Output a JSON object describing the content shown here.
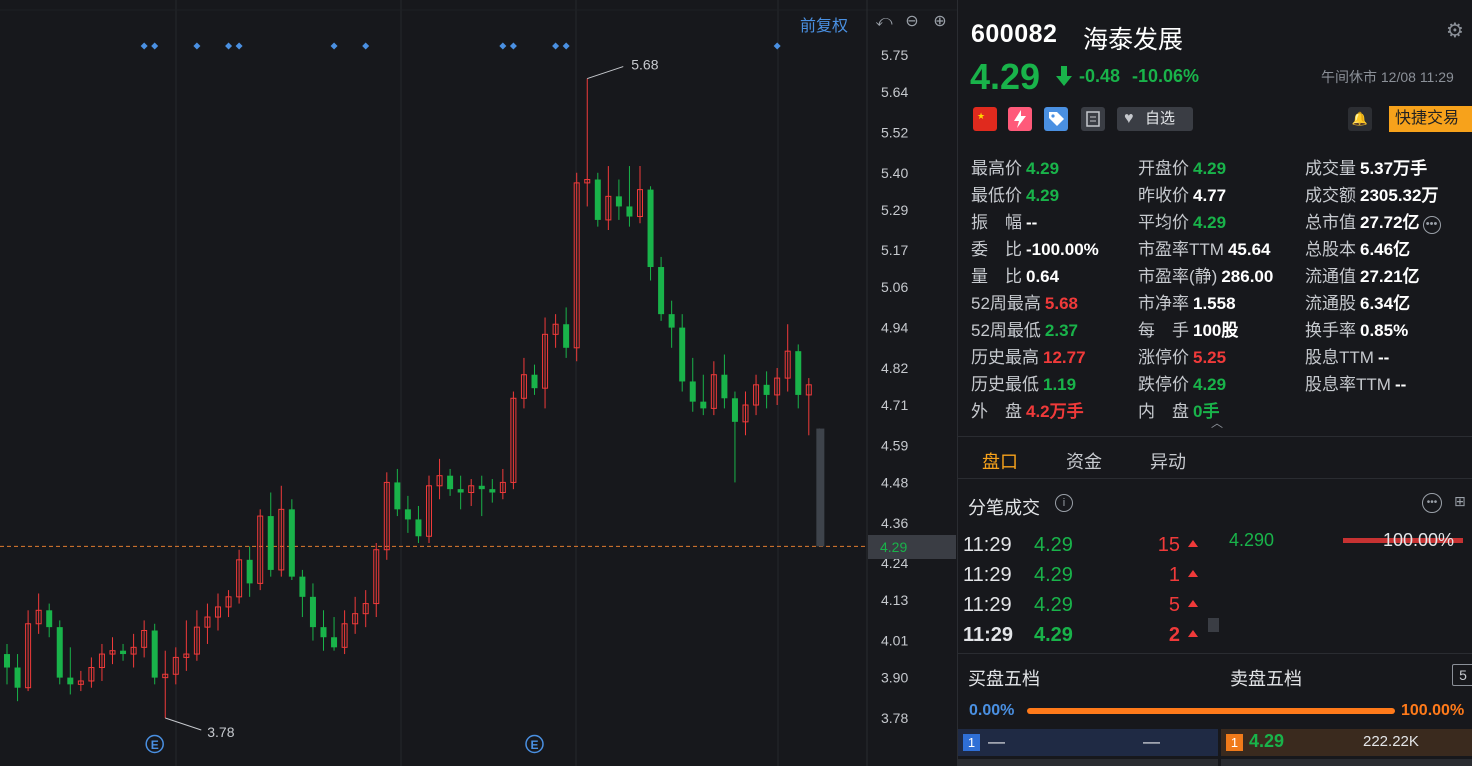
{
  "chart_data": {
    "type": "candlestick",
    "ylim": [
      3.72,
      5.8
    ],
    "y_ticks": [
      "5.75",
      "5.64",
      "5.52",
      "5.40",
      "5.29",
      "5.17",
      "5.06",
      "4.94",
      "4.82",
      "4.71",
      "4.59",
      "4.48",
      "4.36",
      "4.29",
      "4.24",
      "4.13",
      "4.01",
      "3.90",
      "3.78"
    ],
    "current_price": "4.29",
    "high_label": "5.68",
    "low_label": "3.78",
    "event_marker": "E",
    "up_color": "#f03a3a",
    "down_color": "#19b34a",
    "candles": [
      {
        "o": 3.97,
        "h": 4.0,
        "l": 3.88,
        "c": 3.93
      },
      {
        "o": 3.93,
        "h": 3.97,
        "l": 3.83,
        "c": 3.87
      },
      {
        "o": 3.87,
        "h": 4.1,
        "l": 3.86,
        "c": 4.06
      },
      {
        "o": 4.06,
        "h": 4.15,
        "l": 4.03,
        "c": 4.1
      },
      {
        "o": 4.1,
        "h": 4.12,
        "l": 4.02,
        "c": 4.05
      },
      {
        "o": 4.05,
        "h": 4.07,
        "l": 3.88,
        "c": 3.9
      },
      {
        "o": 3.9,
        "h": 3.99,
        "l": 3.85,
        "c": 3.88
      },
      {
        "o": 3.88,
        "h": 3.92,
        "l": 3.86,
        "c": 3.89
      },
      {
        "o": 3.89,
        "h": 3.96,
        "l": 3.87,
        "c": 3.93
      },
      {
        "o": 3.93,
        "h": 4.0,
        "l": 3.89,
        "c": 3.97
      },
      {
        "o": 3.97,
        "h": 4.02,
        "l": 3.94,
        "c": 3.98
      },
      {
        "o": 3.98,
        "h": 4.0,
        "l": 3.95,
        "c": 3.97
      },
      {
        "o": 3.97,
        "h": 4.03,
        "l": 3.93,
        "c": 3.99
      },
      {
        "o": 3.99,
        "h": 4.07,
        "l": 3.96,
        "c": 4.04
      },
      {
        "o": 4.04,
        "h": 4.06,
        "l": 3.88,
        "c": 3.9
      },
      {
        "o": 3.9,
        "h": 3.98,
        "l": 3.78,
        "c": 3.91
      },
      {
        "o": 3.91,
        "h": 3.99,
        "l": 3.88,
        "c": 3.96
      },
      {
        "o": 3.96,
        "h": 4.07,
        "l": 3.92,
        "c": 3.97
      },
      {
        "o": 3.97,
        "h": 4.1,
        "l": 3.95,
        "c": 4.05
      },
      {
        "o": 4.05,
        "h": 4.12,
        "l": 4.0,
        "c": 4.08
      },
      {
        "o": 4.08,
        "h": 4.15,
        "l": 4.04,
        "c": 4.11
      },
      {
        "o": 4.11,
        "h": 4.16,
        "l": 4.08,
        "c": 4.14
      },
      {
        "o": 4.14,
        "h": 4.28,
        "l": 4.12,
        "c": 4.25
      },
      {
        "o": 4.25,
        "h": 4.29,
        "l": 4.14,
        "c": 4.18
      },
      {
        "o": 4.18,
        "h": 4.4,
        "l": 4.16,
        "c": 4.38
      },
      {
        "o": 4.38,
        "h": 4.45,
        "l": 4.2,
        "c": 4.22
      },
      {
        "o": 4.22,
        "h": 4.47,
        "l": 4.2,
        "c": 4.4
      },
      {
        "o": 4.4,
        "h": 4.43,
        "l": 4.19,
        "c": 4.2
      },
      {
        "o": 4.2,
        "h": 4.22,
        "l": 4.08,
        "c": 4.14
      },
      {
        "o": 4.14,
        "h": 4.18,
        "l": 4.01,
        "c": 4.05
      },
      {
        "o": 4.05,
        "h": 4.1,
        "l": 3.98,
        "c": 4.02
      },
      {
        "o": 4.02,
        "h": 4.08,
        "l": 3.98,
        "c": 3.99
      },
      {
        "o": 3.99,
        "h": 4.1,
        "l": 3.97,
        "c": 4.06
      },
      {
        "o": 4.06,
        "h": 4.14,
        "l": 4.03,
        "c": 4.09
      },
      {
        "o": 4.09,
        "h": 4.16,
        "l": 4.05,
        "c": 4.12
      },
      {
        "o": 4.12,
        "h": 4.3,
        "l": 4.08,
        "c": 4.28
      },
      {
        "o": 4.28,
        "h": 4.51,
        "l": 4.25,
        "c": 4.48
      },
      {
        "o": 4.48,
        "h": 4.52,
        "l": 4.38,
        "c": 4.4
      },
      {
        "o": 4.4,
        "h": 4.44,
        "l": 4.33,
        "c": 4.37
      },
      {
        "o": 4.37,
        "h": 4.41,
        "l": 4.3,
        "c": 4.32
      },
      {
        "o": 4.32,
        "h": 4.5,
        "l": 4.3,
        "c": 4.47
      },
      {
        "o": 4.47,
        "h": 4.55,
        "l": 4.43,
        "c": 4.5
      },
      {
        "o": 4.5,
        "h": 4.52,
        "l": 4.44,
        "c": 4.46
      },
      {
        "o": 4.46,
        "h": 4.5,
        "l": 4.4,
        "c": 4.45
      },
      {
        "o": 4.45,
        "h": 4.49,
        "l": 4.41,
        "c": 4.47
      },
      {
        "o": 4.47,
        "h": 4.5,
        "l": 4.38,
        "c": 4.46
      },
      {
        "o": 4.46,
        "h": 4.49,
        "l": 4.42,
        "c": 4.45
      },
      {
        "o": 4.45,
        "h": 4.52,
        "l": 4.43,
        "c": 4.48
      },
      {
        "o": 4.48,
        "h": 4.75,
        "l": 4.46,
        "c": 4.73
      },
      {
        "o": 4.73,
        "h": 4.85,
        "l": 4.7,
        "c": 4.8
      },
      {
        "o": 4.8,
        "h": 4.83,
        "l": 4.74,
        "c": 4.76
      },
      {
        "o": 4.76,
        "h": 4.97,
        "l": 4.7,
        "c": 4.92
      },
      {
        "o": 4.92,
        "h": 4.98,
        "l": 4.88,
        "c": 4.95
      },
      {
        "o": 4.95,
        "h": 5.0,
        "l": 4.85,
        "c": 4.88
      },
      {
        "o": 4.88,
        "h": 5.4,
        "l": 4.84,
        "c": 5.37
      },
      {
        "o": 5.37,
        "h": 5.68,
        "l": 5.3,
        "c": 5.38
      },
      {
        "o": 5.38,
        "h": 5.4,
        "l": 5.24,
        "c": 5.26
      },
      {
        "o": 5.26,
        "h": 5.42,
        "l": 5.23,
        "c": 5.33
      },
      {
        "o": 5.33,
        "h": 5.38,
        "l": 5.26,
        "c": 5.3
      },
      {
        "o": 5.3,
        "h": 5.42,
        "l": 5.24,
        "c": 5.27
      },
      {
        "o": 5.27,
        "h": 5.42,
        "l": 5.25,
        "c": 5.35
      },
      {
        "o": 5.35,
        "h": 5.36,
        "l": 5.08,
        "c": 5.12
      },
      {
        "o": 5.12,
        "h": 5.15,
        "l": 4.96,
        "c": 4.98
      },
      {
        "o": 4.98,
        "h": 5.02,
        "l": 4.88,
        "c": 4.94
      },
      {
        "o": 4.94,
        "h": 4.98,
        "l": 4.75,
        "c": 4.78
      },
      {
        "o": 4.78,
        "h": 4.85,
        "l": 4.69,
        "c": 4.72
      },
      {
        "o": 4.72,
        "h": 4.8,
        "l": 4.68,
        "c": 4.7
      },
      {
        "o": 4.7,
        "h": 4.84,
        "l": 4.68,
        "c": 4.8
      },
      {
        "o": 4.8,
        "h": 4.86,
        "l": 4.7,
        "c": 4.73
      },
      {
        "o": 4.73,
        "h": 4.75,
        "l": 4.48,
        "c": 4.66
      },
      {
        "o": 4.66,
        "h": 4.75,
        "l": 4.62,
        "c": 4.71
      },
      {
        "o": 4.71,
        "h": 4.8,
        "l": 4.68,
        "c": 4.77
      },
      {
        "o": 4.77,
        "h": 4.81,
        "l": 4.7,
        "c": 4.74
      },
      {
        "o": 4.74,
        "h": 4.82,
        "l": 4.71,
        "c": 4.79
      },
      {
        "o": 4.79,
        "h": 4.95,
        "l": 4.75,
        "c": 4.87
      },
      {
        "o": 4.87,
        "h": 4.89,
        "l": 4.7,
        "c": 4.74
      },
      {
        "o": 4.74,
        "h": 4.79,
        "l": 4.62,
        "c": 4.77
      },
      {
        "o": 4.64,
        "h": 4.64,
        "l": 4.29,
        "c": 4.29
      }
    ],
    "ann_dates": [
      {
        "i": 14,
        "text": "E"
      },
      {
        "i": 50,
        "text": "E"
      }
    ],
    "signal_markers": [
      13,
      14,
      18,
      21,
      22,
      31,
      34,
      47,
      48,
      52,
      53,
      73
    ]
  },
  "toolbar": {
    "fq_label": "前复权",
    "undo_icon": "undo-icon",
    "zoom_out_icon": "zoom-out-icon",
    "zoom_in_icon": "zoom-in-icon"
  },
  "header": {
    "code": "600082",
    "name": "海泰发展",
    "price": "4.29",
    "change": "-0.48",
    "change_pct": "-10.06%",
    "session": "午间休市 12/08 11:29",
    "fav_label": "自选",
    "trade_label": "快捷交易"
  },
  "stats": {
    "col1": [
      {
        "label": "最高价",
        "value": "4.29",
        "color": "green"
      },
      {
        "label": "最低价",
        "value": "4.29",
        "color": "green"
      },
      {
        "label": "振　幅",
        "value": "--",
        "color": "white"
      },
      {
        "label": "委　比",
        "value": "-100.00%",
        "color": "white"
      },
      {
        "label": "量　比",
        "value": "0.64",
        "color": "white"
      },
      {
        "label": "52周最高",
        "value": "5.68",
        "color": "red"
      },
      {
        "label": "52周最低",
        "value": "2.37",
        "color": "green"
      },
      {
        "label": "历史最高",
        "value": "12.77",
        "color": "red"
      },
      {
        "label": "历史最低",
        "value": "1.19",
        "color": "green"
      },
      {
        "label": "外　盘",
        "value": "4.2万手",
        "color": "red"
      }
    ],
    "col2": [
      {
        "label": "开盘价",
        "value": "4.29",
        "color": "green"
      },
      {
        "label": "昨收价",
        "value": "4.77",
        "color": "white"
      },
      {
        "label": "平均价",
        "value": "4.29",
        "color": "green"
      },
      {
        "label": "市盈率TTM",
        "value": "45.64",
        "color": "white"
      },
      {
        "label": "市盈率(静)",
        "value": "286.00",
        "color": "white"
      },
      {
        "label": "市净率",
        "value": "1.558",
        "color": "white"
      },
      {
        "label": "每　手",
        "value": "100股",
        "color": "white"
      },
      {
        "label": "涨停价",
        "value": "5.25",
        "color": "red"
      },
      {
        "label": "跌停价",
        "value": "4.29",
        "color": "green"
      },
      {
        "label": "内　盘",
        "value": "0手",
        "color": "green"
      }
    ],
    "col3": [
      {
        "label": "成交量",
        "value": "5.37万手",
        "color": "white"
      },
      {
        "label": "成交额",
        "value": "2305.32万",
        "color": "white"
      },
      {
        "label": "总市值",
        "value": "27.72亿",
        "color": "white"
      },
      {
        "label": "总股本",
        "value": "6.46亿",
        "color": "white"
      },
      {
        "label": "流通值",
        "value": "27.21亿",
        "color": "white"
      },
      {
        "label": "流通股",
        "value": "6.34亿",
        "color": "white"
      },
      {
        "label": "换手率",
        "value": "0.85%",
        "color": "white"
      },
      {
        "label": "股息TTM",
        "value": "--",
        "color": "white"
      },
      {
        "label": "股息率TTM",
        "value": "--",
        "color": "white"
      }
    ]
  },
  "tabs": [
    "盘口",
    "资金",
    "异动"
  ],
  "ticks": {
    "title": "分笔成交",
    "rows": [
      {
        "time": "11:29",
        "price": "4.29",
        "vol": "15"
      },
      {
        "time": "11:29",
        "price": "4.29",
        "vol": "1"
      },
      {
        "time": "11:29",
        "price": "4.29",
        "vol": "5"
      },
      {
        "time": "11:29",
        "price": "4.29",
        "vol": "2"
      }
    ],
    "dist_price": "4.290",
    "dist_pct": "100.00%"
  },
  "book": {
    "bid_title": "买盘五档",
    "ask_title": "卖盘五档",
    "level": "5",
    "bid_ratio": "0.00%",
    "ask_ratio": "100.00%",
    "bid1": {
      "lvl": "1",
      "price": "—",
      "vol": "—"
    },
    "ask1": {
      "lvl": "1",
      "price": "4.29",
      "vol": "222.22K"
    }
  }
}
